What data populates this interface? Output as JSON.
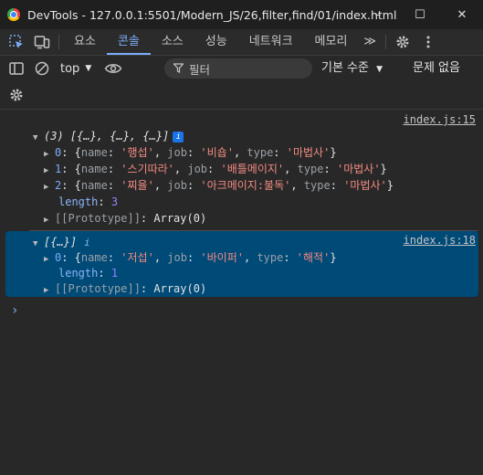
{
  "window": {
    "title": "DevTools - 127.0.0.1:5501/Modern_JS/26,filter,find/01/index.html",
    "minimize": "–",
    "maximize": "☐",
    "close": "✕"
  },
  "tabs": [
    {
      "label": "요소"
    },
    {
      "label": "콘솔"
    },
    {
      "label": "소스"
    },
    {
      "label": "성능"
    },
    {
      "label": "네트워크"
    },
    {
      "label": "메모리"
    }
  ],
  "tabs_more": "≫",
  "toolbar": {
    "context": "top",
    "filter_placeholder": "필터",
    "levels": "기본 수준",
    "issues": "문제 없음"
  },
  "console": {
    "entries": [
      {
        "source": "index.js:15",
        "summary": "(3) [{…}, {…}, {…}]",
        "badge": "i",
        "items": [
          {
            "index": "0",
            "name": "'행섭'",
            "job": "'비숍'",
            "type": "'마법사'"
          },
          {
            "index": "1",
            "name": "'스기따라'",
            "job": "'배틀메이지'",
            "type": "'마법사'"
          },
          {
            "index": "2",
            "name": "'찌율'",
            "job": "'아크메이지:불독'",
            "type": "'마법사'"
          }
        ],
        "length_label": "length",
        "length_value": "3",
        "prototype": "[[Prototype]]",
        "prototype_value": "Array(0)"
      },
      {
        "source": "index.js:18",
        "summary": "[{…}]",
        "badge": "i",
        "items": [
          {
            "index": "0",
            "name": "'저섭'",
            "job": "'바이퍼'",
            "type": "'해적'"
          }
        ],
        "length_label": "length",
        "length_value": "1",
        "prototype": "[[Prototype]]",
        "prototype_value": "Array(0)"
      }
    ],
    "prompt": "›"
  },
  "labels": {
    "name_key": "name",
    "job_key": "job",
    "type_key": "type"
  },
  "colors": {
    "accent": "#7cacf8",
    "selected_row": "#004a77",
    "string": "#f28b82",
    "number": "#9980ff"
  }
}
